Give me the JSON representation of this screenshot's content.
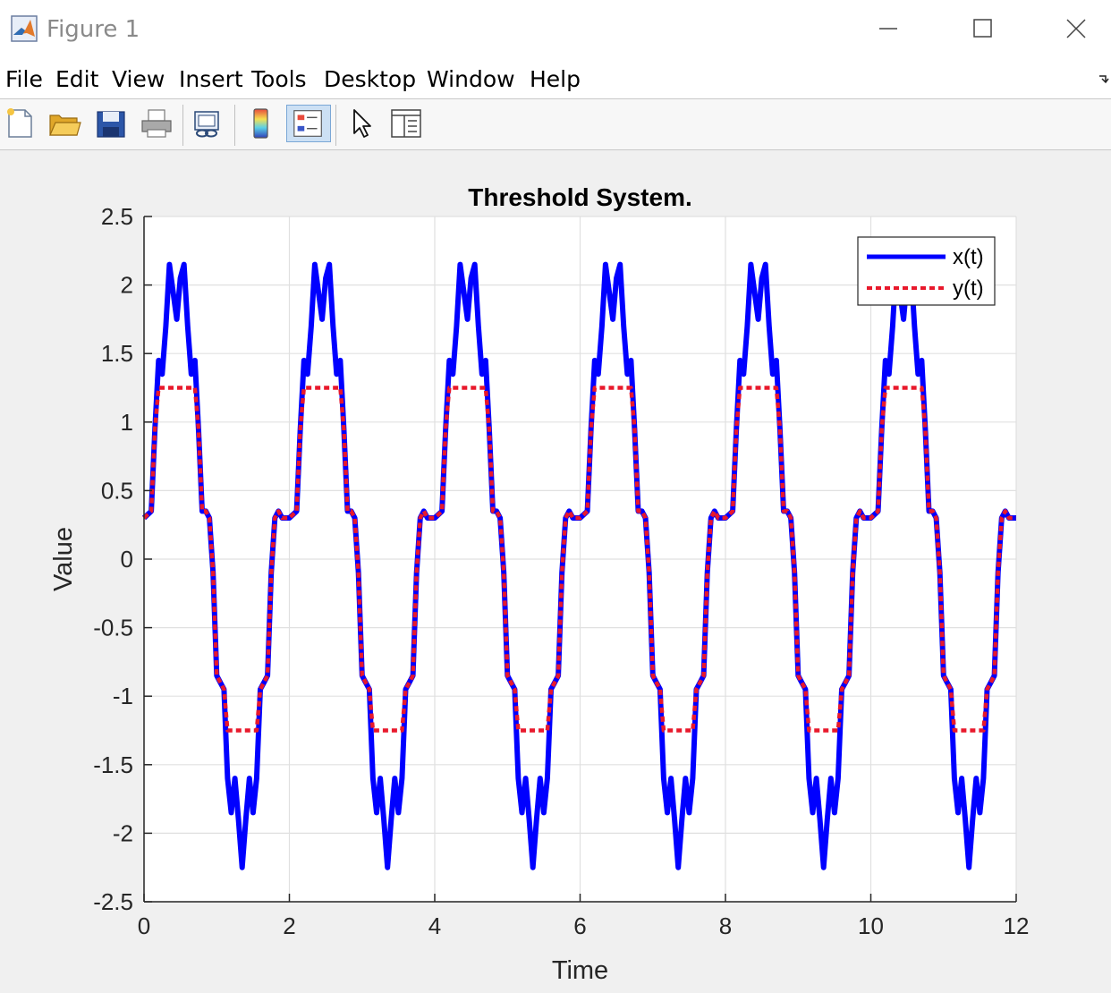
{
  "window": {
    "title": "Figure 1",
    "buttons": [
      "minimize",
      "maximize",
      "close"
    ]
  },
  "menu": {
    "items": [
      "File",
      "Edit",
      "View",
      "Insert",
      "Tools",
      "Desktop",
      "Window",
      "Help"
    ]
  },
  "toolbar": {
    "items": [
      {
        "icon": "new-figure-icon",
        "pressed": false
      },
      {
        "icon": "open-file-icon",
        "pressed": false
      },
      {
        "icon": "save-icon",
        "pressed": false
      },
      {
        "icon": "print-icon",
        "pressed": false
      },
      {
        "icon": "link-plot-icon",
        "pressed": false
      },
      {
        "icon": "insert-colorbar-icon",
        "pressed": false
      },
      {
        "icon": "insert-legend-icon",
        "pressed": true
      },
      {
        "icon": "edit-plot-icon",
        "pressed": false
      },
      {
        "icon": "property-inspector-icon",
        "pressed": false
      }
    ]
  },
  "chart_data": {
    "type": "line",
    "title": "Threshold System.",
    "xlabel": "Time",
    "ylabel": "Value",
    "xlim": [
      0,
      12
    ],
    "ylim": [
      -2.5,
      2.5
    ],
    "xticks": [
      0,
      2,
      4,
      6,
      8,
      10,
      12
    ],
    "yticks": [
      2.5,
      2,
      1.5,
      1,
      0.5,
      0,
      -0.5,
      -1,
      -1.5,
      -2,
      -2.5
    ],
    "grid": true,
    "legend_position": "top-right",
    "series": [
      {
        "name": "x(t)",
        "color": "#0000ff",
        "style": "solid",
        "x": [
          0,
          0.1,
          0.15,
          0.2,
          0.25,
          0.3,
          0.35,
          0.4,
          0.45,
          0.5,
          0.55,
          0.6,
          0.65,
          0.7,
          0.75,
          0.8,
          0.85,
          0.9,
          0.95,
          1.0,
          1.05,
          1.1,
          1.15,
          1.2,
          1.25,
          1.3,
          1.35,
          1.4,
          1.45,
          1.5,
          1.55,
          1.6,
          1.65,
          1.7,
          1.75,
          1.8,
          1.85,
          1.9,
          1.95,
          2.0
        ],
        "values": [
          0.3,
          0.35,
          0.95,
          1.45,
          1.35,
          1.7,
          2.15,
          1.95,
          1.75,
          2.05,
          2.15,
          1.7,
          1.35,
          1.45,
          0.95,
          0.35,
          0.35,
          0.3,
          -0.1,
          -0.85,
          -0.9,
          -0.95,
          -1.6,
          -1.85,
          -1.6,
          -1.9,
          -2.25,
          -1.9,
          -1.6,
          -1.85,
          -1.6,
          -0.95,
          -0.9,
          -0.85,
          -0.1,
          0.3,
          0.35,
          0.3,
          0.3,
          0.3
        ]
      },
      {
        "name": "y(t)",
        "color": "#e8192c",
        "style": "dotted",
        "x": [
          0,
          0.1,
          0.15,
          0.2,
          0.25,
          0.3,
          0.35,
          0.4,
          0.45,
          0.5,
          0.55,
          0.6,
          0.65,
          0.7,
          0.75,
          0.8,
          0.85,
          0.9,
          0.95,
          1.0,
          1.05,
          1.1,
          1.15,
          1.2,
          1.25,
          1.3,
          1.35,
          1.4,
          1.45,
          1.5,
          1.55,
          1.6,
          1.65,
          1.7,
          1.75,
          1.8,
          1.85,
          1.9,
          1.95,
          2.0
        ],
        "values": [
          0.3,
          0.35,
          0.95,
          1.25,
          1.25,
          1.25,
          1.25,
          1.25,
          1.25,
          1.25,
          1.25,
          1.25,
          1.25,
          1.25,
          0.95,
          0.35,
          0.35,
          0.3,
          -0.1,
          -0.85,
          -0.9,
          -0.95,
          -1.25,
          -1.25,
          -1.25,
          -1.25,
          -1.25,
          -1.25,
          -1.25,
          -1.25,
          -1.25,
          -0.95,
          -0.9,
          -0.85,
          -0.1,
          0.3,
          0.35,
          0.3,
          0.3,
          0.3
        ]
      }
    ],
    "period": 2,
    "note_series_repeat": "The values shown for 0–2 repeat every 2 time units through 12."
  }
}
